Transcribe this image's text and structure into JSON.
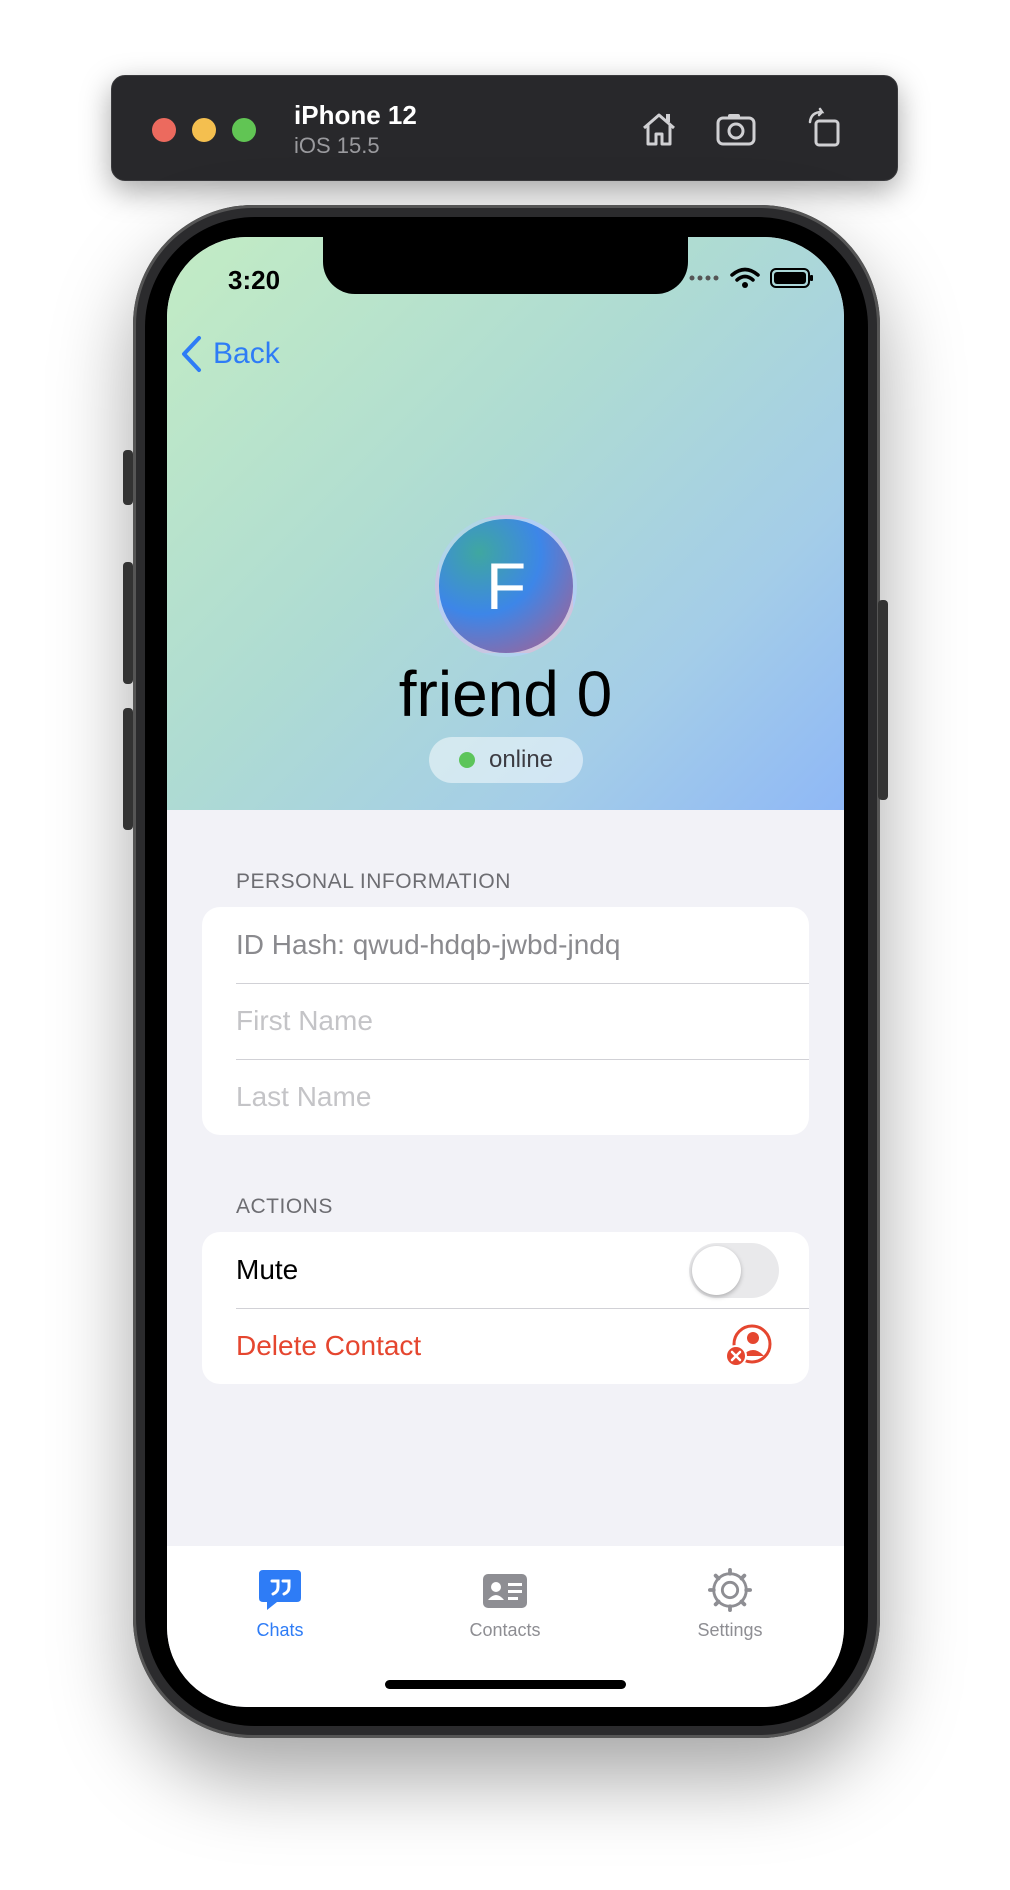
{
  "simulator": {
    "device_name": "iPhone 12",
    "os_version": "iOS 15.5",
    "icons": [
      "home-icon",
      "screenshot-icon",
      "rotate-icon"
    ]
  },
  "status_bar": {
    "time": "3:20"
  },
  "nav": {
    "back_label": "Back"
  },
  "profile": {
    "avatar_letter": "F",
    "name": "friend 0",
    "status": "online",
    "status_color": "#5cc55b"
  },
  "personal_information": {
    "header": "PERSONAL INFORMATION",
    "id_hash": "ID Hash: qwud-hdqb-jwbd-jndq",
    "first_name_placeholder": "First Name",
    "last_name_placeholder": "Last Name"
  },
  "actions": {
    "header": "ACTIONS",
    "mute_label": "Mute",
    "mute_on": false,
    "delete_label": "Delete Contact"
  },
  "tabbar": {
    "tabs": [
      {
        "label": "Chats",
        "icon": "chat-bubble-icon",
        "active": true
      },
      {
        "label": "Contacts",
        "icon": "contact-card-icon",
        "active": false
      },
      {
        "label": "Settings",
        "icon": "gear-icon",
        "active": false
      }
    ]
  },
  "colors": {
    "accent": "#2e7cf6",
    "destructive": "#e5462f",
    "background": "#f2f2f7"
  }
}
